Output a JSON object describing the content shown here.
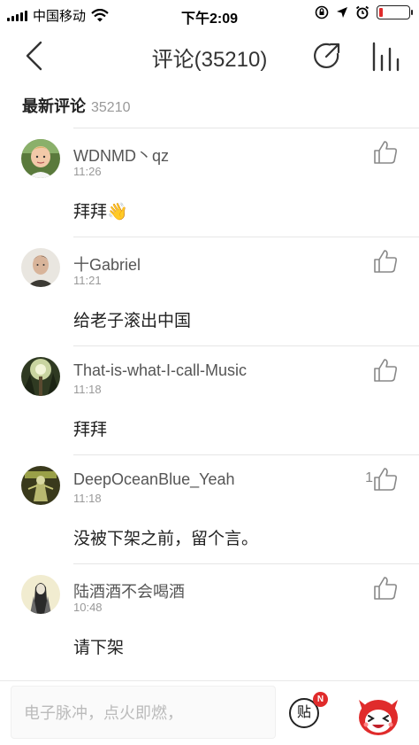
{
  "status_bar": {
    "carrier": "中国移动",
    "time": "下午2:09",
    "battery_level": 0.12
  },
  "nav": {
    "title": "评论(35210)"
  },
  "section": {
    "label": "最新评论",
    "count": "35210"
  },
  "comments": [
    {
      "name": "WDNMD丶qz",
      "time": "11:26",
      "text": "拜拜👋",
      "likes": ""
    },
    {
      "name": "十Gabriel",
      "time": "11:21",
      "text": "给老子滚出中国",
      "likes": ""
    },
    {
      "name": "That-is-what-I-call-Music",
      "time": "11:18",
      "text": "拜拜",
      "likes": ""
    },
    {
      "name": "DeepOceanBlue_Yeah",
      "time": "11:18",
      "text": "没被下架之前，留个言。",
      "likes": "1"
    },
    {
      "name": "陆酒酒不会喝酒",
      "time": "10:48",
      "text": "请下架",
      "likes": ""
    }
  ],
  "composer": {
    "placeholder": "电子脉冲，点火即燃，",
    "tie_label": "贴",
    "badge": "N"
  },
  "colors": {
    "accent": "#e02b2b",
    "text": "#333333",
    "muted": "#999999"
  }
}
